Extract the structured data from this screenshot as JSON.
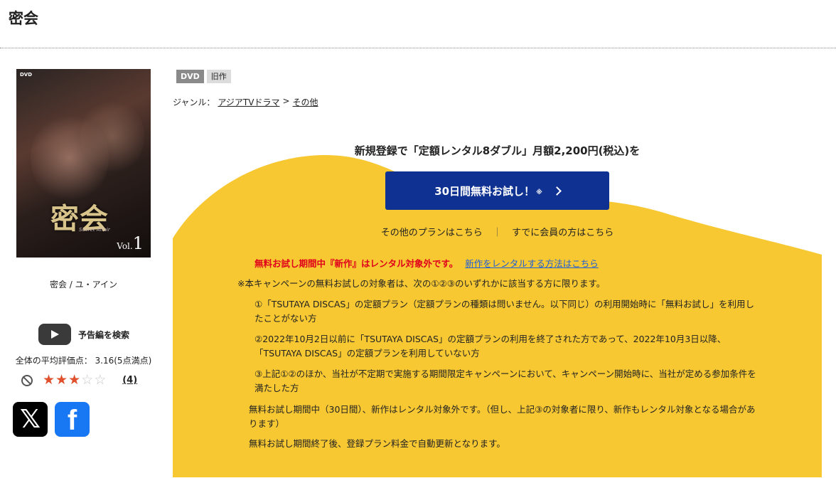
{
  "page": {
    "title": "密会"
  },
  "product": {
    "cover": {
      "dvd_mark": "DVD",
      "title_text": "密会",
      "subtitle_text": "Secret Affair",
      "vol_prefix": "Vol.",
      "vol_number": "1"
    },
    "cast_line": "密会 / ユ・アイン",
    "trailer_label": "予告編を検索",
    "average_rating_text": "全体の平均評価点： 3.16(5点満点)",
    "rating": {
      "stars_filled": 3,
      "stars_total": 5,
      "review_count": "(4)"
    },
    "badges": [
      "DVD",
      "旧作"
    ],
    "genre": {
      "label": "ジャンル：",
      "path1": "アジアTVドラマ",
      "sep": ">",
      "path2": "その他"
    }
  },
  "share": {
    "x_glyph": "𝕏",
    "facebook_glyph": "f"
  },
  "promo": {
    "headline": "新規登録で「定額レンタル8ダブル」月額2,200円(税込)を",
    "cta_label": "30日間無料お試し！",
    "cta_note": "※",
    "other_plans_link": "その他のプランはこちら",
    "links_separator": "｜",
    "members_link": "すでに会員の方はこちら",
    "warning_red": "無料お試し期間中『新作』はレンタル対象外です。",
    "warning_link": "新作をレンタルする方法はこちら",
    "note0": "※本キャンペーンの無料お試しの対象者は、次の①②③のいずれかに該当する方に限ります。",
    "note1": "①「TSUTAYA DISCAS」の定額プラン（定額プランの種類は問いません。以下同じ）の利用開始時に「無料お試し」を利用したことがない方",
    "note2": "②2022年10月2日以前に「TSUTAYA DISCAS」の定額プランの利用を終了された方であって、2022年10月3日以降、「TSUTAYA DISCAS」の定額プランを利用していない方",
    "note3": "③上記①②のほか、当社が不定期で実施する期間限定キャンペーンにおいて、キャンペーン開始時に、当社が定める参加条件を満たした方",
    "note4": "無料お試し期間中（30日間）、新作はレンタル対象外です。（但し、上記③の対象者に限り、新作もレンタル対象となる場合があります）",
    "note5": "無料お試し期間終了後、登録プラン料金で自動更新となります。"
  },
  "colors": {
    "cta_bg": "#0e3192",
    "promo_yellow": "#f7c832",
    "warning_red": "#e0001b",
    "link_blue": "#1f5fd6",
    "star_on": "#e0502c"
  }
}
